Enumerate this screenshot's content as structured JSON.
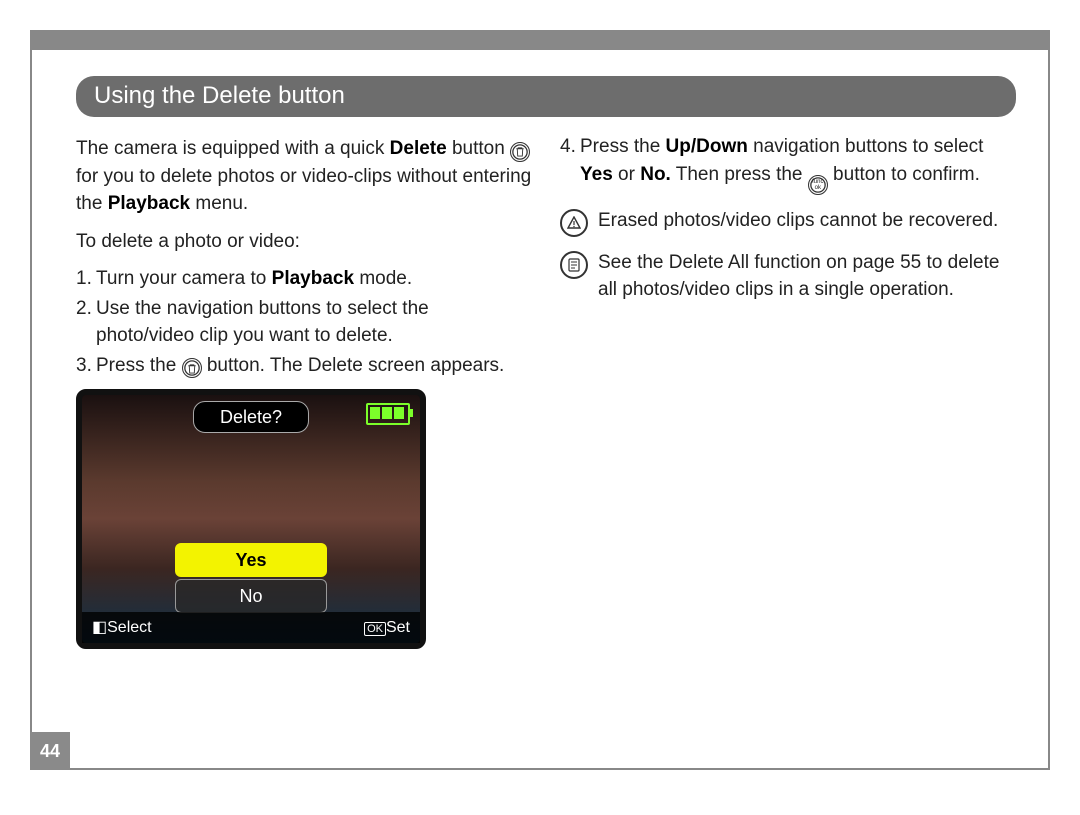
{
  "page_number": "44",
  "heading": "Using the Delete button",
  "left": {
    "intro_a": "The camera is equipped with a quick ",
    "intro_b_bold": "Delete",
    "intro_c": " button ",
    "intro_d": " for you to delete photos or video-clips without entering the ",
    "intro_e_bold": "Playback",
    "intro_f": " menu.",
    "subhead": "To delete a photo or video:",
    "s1_a": "Turn your camera to ",
    "s1_b_bold": "Playback",
    "s1_c": " mode.",
    "s2": "Use the navigation buttons to select the photo/video clip you want to delete.",
    "s3_a": "Press the ",
    "s3_b": " button. The Delete screen appears."
  },
  "right": {
    "s4_a": "Press the ",
    "s4_b_bold": "Up/Down",
    "s4_c": " navigation buttons to select ",
    "s4_d_bold": "Yes",
    "s4_e": " or ",
    "s4_f_bold": "No.",
    "s4_g": " Then press the ",
    "s4_h": " button to confirm.",
    "note1": "Erased photos/video clips cannot be recovered.",
    "note2": "See the Delete All function on page 55 to delete all photos/video clips in a single operation."
  },
  "lcd": {
    "title": "Delete?",
    "yes": "Yes",
    "no": "No",
    "select_label": "Select",
    "set_label": "Set",
    "ok_prefix": "OK"
  },
  "icons": {
    "trash": "trash-icon",
    "func": "func-ok-icon",
    "warning": "warning-icon",
    "note": "note-icon"
  }
}
